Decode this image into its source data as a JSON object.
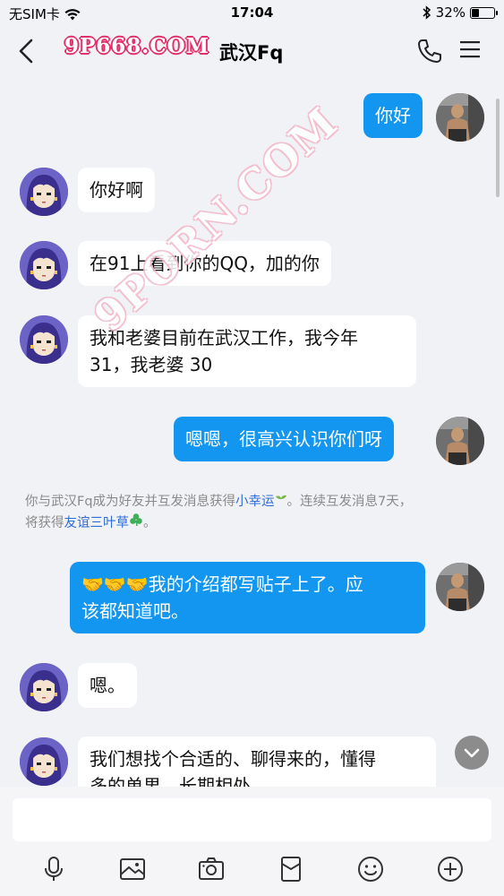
{
  "status_bar": {
    "carrier": "无SIM卡",
    "time": "17:04",
    "battery_percent": "32%",
    "battery_level": 0.32
  },
  "nav": {
    "title": "武汉Fq",
    "watermark": "9P668.COM"
  },
  "watermark_diagonal": "9PORN.COM",
  "messages": [
    {
      "side": "out",
      "text": "你好"
    },
    {
      "side": "in",
      "text": "你好啊"
    },
    {
      "side": "in",
      "text": "在91上看到你的QQ，加的你"
    },
    {
      "side": "in",
      "line1": "我和老婆目前在武汉工作，我今年",
      "line2": "31，我老婆 30"
    },
    {
      "side": "out",
      "text": "嗯嗯，很高兴认识你们呀"
    },
    {
      "side": "out",
      "emoji": "🤝🤝🤝",
      "line1": "我的介绍都写贴子上了。应",
      "line2": "该都知道吧。"
    },
    {
      "side": "in",
      "text": "嗯。"
    },
    {
      "side": "in",
      "line1": "我们想找个合适的、聊得来的，懂得",
      "line2": "多的单男，长期相处"
    }
  ],
  "system_notice": {
    "part1": "你与武汉Fq成为好友并互发消息获得",
    "link1": "小幸运",
    "part2": "。连续互发消息7天，",
    "part3": "将获得",
    "link2": "友谊三叶草",
    "part4": "。"
  },
  "toolbar": {
    "icons": [
      "microphone-icon",
      "image-icon",
      "camera-icon",
      "red-packet-icon",
      "emoji-icon",
      "plus-icon"
    ]
  },
  "colors": {
    "outgoing_bubble": "#1296f0",
    "incoming_bubble": "#ffffff",
    "link": "#2f6ed8"
  }
}
